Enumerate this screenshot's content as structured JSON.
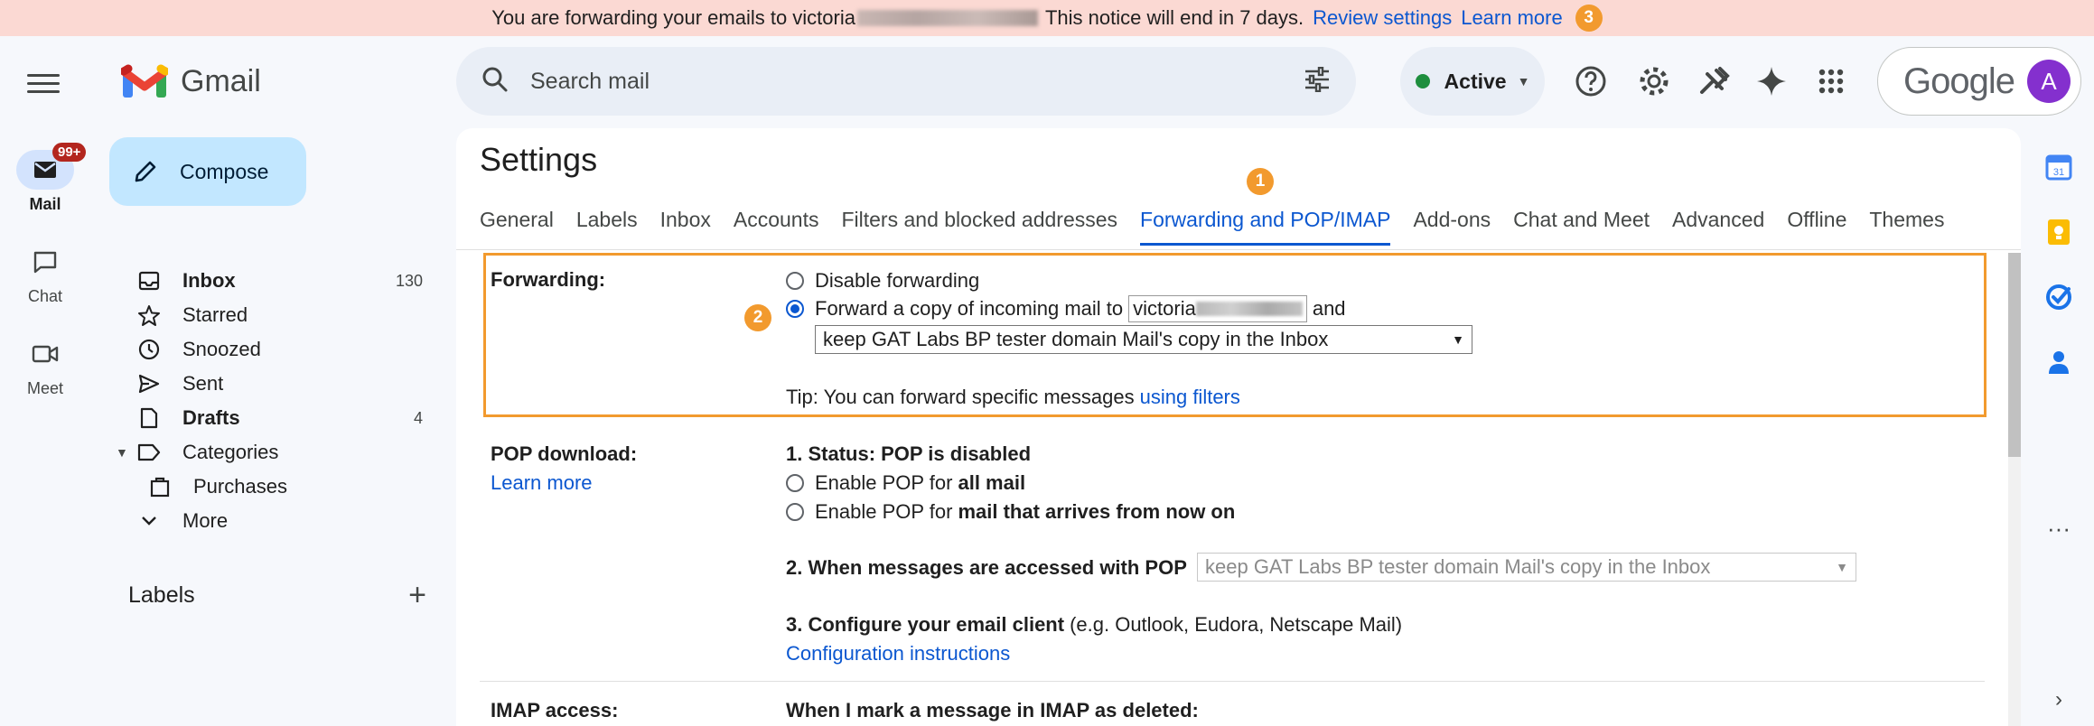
{
  "notice": {
    "text_before": "You are forwarding your emails to victoria",
    "text_after": "This notice will end in 7 days.",
    "review_link": "Review settings",
    "learn_link": "Learn more",
    "badge": "3"
  },
  "rail": {
    "items": [
      {
        "label": "Mail",
        "count": "99+"
      },
      {
        "label": "Chat"
      },
      {
        "label": "Meet"
      }
    ]
  },
  "brand": {
    "name": "Gmail"
  },
  "compose": {
    "label": "Compose"
  },
  "nav": [
    {
      "label": "Inbox",
      "count": "130"
    },
    {
      "label": "Starred"
    },
    {
      "label": "Snoozed"
    },
    {
      "label": "Sent"
    },
    {
      "label": "Drafts",
      "count": "4"
    },
    {
      "label": "Categories"
    },
    {
      "label": "Purchases"
    },
    {
      "label": "More"
    }
  ],
  "labels": {
    "heading": "Labels"
  },
  "search": {
    "placeholder": "Search mail"
  },
  "status": {
    "label": "Active"
  },
  "account": {
    "brand": "Google",
    "avatar_letter": "A"
  },
  "settings": {
    "title": "Settings",
    "tabs": [
      "General",
      "Labels",
      "Inbox",
      "Accounts",
      "Filters and blocked addresses",
      "Forwarding and POP/IMAP",
      "Add-ons",
      "Chat and Meet",
      "Advanced",
      "Offline",
      "Themes"
    ],
    "tab_badge": "1",
    "forwarding": {
      "label": "Forwarding:",
      "badge": "2",
      "disable": "Disable forwarding",
      "forward_prefix": "Forward a copy of incoming mail to",
      "address_visible": "victoria",
      "forward_suffix": "and",
      "select_value": "keep GAT Labs BP tester domain Mail's copy in the Inbox",
      "tip_prefix": "Tip: You can forward specific messages",
      "tip_link": "using filters"
    },
    "pop": {
      "label": "POP download:",
      "learn_more": "Learn more",
      "status": "1. Status: POP is disabled",
      "enable_all_prefix": "Enable POP for",
      "enable_all_bold": "all mail",
      "enable_new_prefix": "Enable POP for",
      "enable_new_bold": "mail that arrives from now on",
      "accessed_label": "2. When messages are accessed with POP",
      "accessed_select": "keep GAT Labs BP tester domain Mail's copy in the Inbox",
      "configure_bold": "3. Configure your email client",
      "configure_rest": "(e.g. Outlook, Eudora, Netscape Mail)",
      "config_link": "Configuration instructions"
    },
    "imap": {
      "label": "IMAP access:",
      "deleted_heading": "When I mark a message in IMAP as deleted:"
    }
  },
  "colors": {
    "accent": "#0b57d0",
    "highlight": "#f29a2e",
    "banner": "#fbd9d3",
    "compose": "#c2e7ff"
  }
}
